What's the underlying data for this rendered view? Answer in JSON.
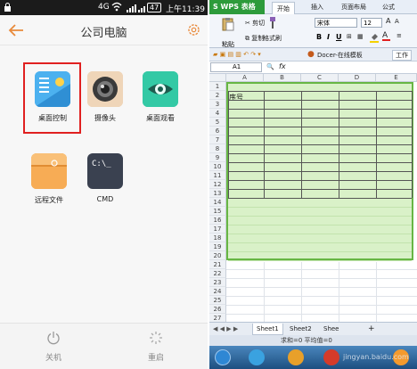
{
  "phone": {
    "status": {
      "network": "4G",
      "badge": "47",
      "time": "上午11:39"
    },
    "header": {
      "title": "公司电脑"
    },
    "apps": [
      {
        "label": "桌面控制"
      },
      {
        "label": "摄像头"
      },
      {
        "label": "桌面观看"
      },
      {
        "label": "远程文件"
      },
      {
        "label": "CMD",
        "tile_text": "C:\\_"
      }
    ],
    "footer": {
      "shutdown": "关机",
      "restart": "重启"
    }
  },
  "wps": {
    "logo": "S WPS 表格",
    "tabs": [
      "开始",
      "插入",
      "页面布局",
      "公式"
    ],
    "ribbon": {
      "paste": "粘贴",
      "cut": "剪切",
      "copy": "复制",
      "format_painter": "格式刷",
      "font_name": "宋体",
      "font_size": "12"
    },
    "toolbar2": {
      "docer": "Docer-在线模板",
      "workbook": "工作"
    },
    "formula": {
      "cell": "A1",
      "fx": "fx"
    },
    "columns": [
      "A",
      "B",
      "C",
      "D",
      "E"
    ],
    "rows": [
      "1",
      "2",
      "3",
      "4",
      "5",
      "6",
      "7",
      "8",
      "9",
      "10",
      "11",
      "12",
      "13",
      "14",
      "15",
      "16",
      "17",
      "18",
      "19",
      "20",
      "21",
      "22",
      "23",
      "24",
      "25",
      "26",
      "27"
    ],
    "cell_a2": "序号",
    "sheets": [
      "Sheet1",
      "Sheet2",
      "Shee"
    ],
    "status": "求和=0  平均值=0",
    "watermark": "jingyan.baidu.com"
  }
}
